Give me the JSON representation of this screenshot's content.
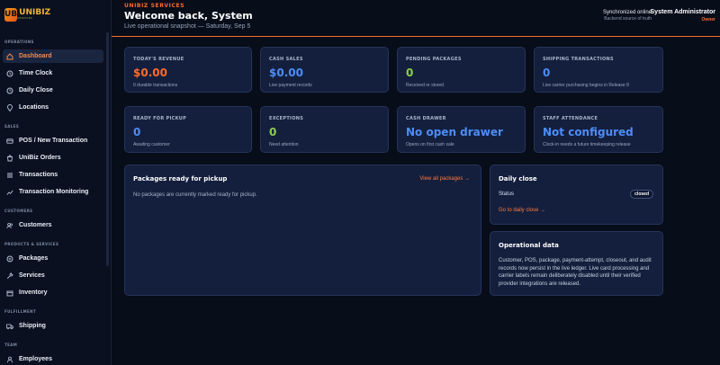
{
  "sidebar": {
    "logo": {
      "mark": "UB",
      "name": "UNIBIZ",
      "tagline": "SERVICES"
    },
    "sections": [
      {
        "title": "OPERATIONS"
      },
      {
        "title": "SALES"
      },
      {
        "title": "CUSTOMERS"
      },
      {
        "title": "PRODUCTS & SERVICES"
      },
      {
        "title": "FULFILLMENT"
      },
      {
        "title": "TEAM"
      }
    ],
    "items": [
      {
        "label": "Dashboard",
        "icon": "home-icon",
        "active": true
      },
      {
        "label": "Time Clock",
        "icon": "clock-icon"
      },
      {
        "label": "Daily Close",
        "icon": "calendar-icon"
      },
      {
        "label": "Locations",
        "icon": "pin-icon"
      },
      {
        "label": "POS / New Transaction",
        "icon": "card-icon"
      },
      {
        "label": "UniBiz Orders",
        "icon": "bag-icon"
      },
      {
        "label": "Transactions",
        "icon": "list-icon"
      },
      {
        "label": "Transaction Monitoring",
        "icon": "chart-icon"
      },
      {
        "label": "Customers",
        "icon": "users-icon"
      },
      {
        "label": "Packages",
        "icon": "package-icon"
      },
      {
        "label": "Services",
        "icon": "wrench-icon"
      },
      {
        "label": "Inventory",
        "icon": "box-icon"
      },
      {
        "label": "Shipping",
        "icon": "truck-icon"
      },
      {
        "label": "Employees",
        "icon": "people-icon"
      }
    ]
  },
  "header": {
    "brand": "UNIBIZ SERVICES",
    "title": "Welcome back, System",
    "subtitle": "Live operational snapshot — Saturday, Sep 5",
    "sync_title": "Synchronized online",
    "sync_sub": "Backend source of truth",
    "user_name": "System Administrator",
    "user_role": "Owner"
  },
  "stats": [
    {
      "label": "TODAY'S REVENUE",
      "value": "$0.00",
      "note": "0 durable transactions",
      "color": "#ff6a2b"
    },
    {
      "label": "CASH SALES",
      "value": "$0.00",
      "note": "Live payment records",
      "color": "#4d8df7"
    },
    {
      "label": "PENDING PACKAGES",
      "value": "0",
      "note": "Received or stored",
      "color": "#8bcf4a"
    },
    {
      "label": "SHIPPING TRANSACTIONS",
      "value": "0",
      "note": "Live carrier purchasing begins in Release 8",
      "color": "#4d8df7"
    },
    {
      "label": "READY FOR PICKUP",
      "value": "0",
      "note": "Awaiting customer",
      "color": "#4d8df7"
    },
    {
      "label": "EXCEPTIONS",
      "value": "0",
      "note": "Need attention",
      "color": "#8bcf4a"
    },
    {
      "label": "CASH DRAWER",
      "value": "No open drawer",
      "note": "Opens on first cash sale",
      "color": "#4d8df7"
    },
    {
      "label": "STAFF ATTENDANCE",
      "value": "Not configured",
      "note": "Clock-in needs a future timekeeping release",
      "color": "#4d8df7"
    }
  ],
  "pickup": {
    "title": "Packages ready for pickup",
    "link": "View all packages →",
    "empty": "No packages are currently marked ready for pickup."
  },
  "daily_close": {
    "title": "Daily close",
    "status_label": "Status",
    "status_value": "closed",
    "link": "Go to daily close →"
  },
  "operational": {
    "title": "Operational data",
    "text": "Customer, POS, package, payment-attempt, closeout, and audit records now persist in the live ledger. Live card processing and carrier labels remain deliberately disabled until their verified provider integrations are released."
  }
}
